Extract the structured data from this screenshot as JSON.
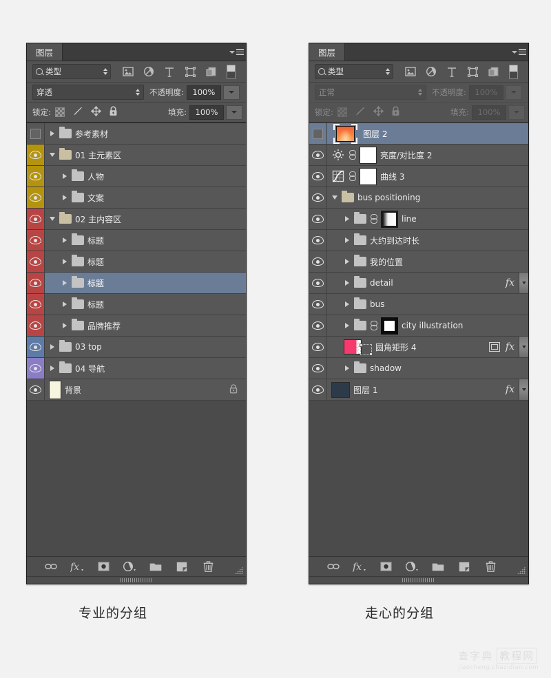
{
  "panels": [
    {
      "id": "left",
      "tab_label": "图层",
      "filter": {
        "kind_label": "类型",
        "icons": [
          "pixel-filter-icon",
          "adjustment-filter-icon",
          "type-filter-icon",
          "shape-filter-icon",
          "smartobject-filter-icon",
          "filter-toggle-switch"
        ]
      },
      "blend": {
        "mode": "穿透",
        "opacity_label": "不透明度:",
        "opacity_value": "100%",
        "disabled": false
      },
      "lock": {
        "label": "锁定:",
        "fill_label": "填充:",
        "fill_value": "100%",
        "icons": [
          "lock-transparency-icon",
          "lock-image-icon",
          "lock-position-icon",
          "lock-all-icon"
        ],
        "disabled": false
      },
      "layers": [
        {
          "name": "参考素材",
          "type": "group",
          "indent": 0,
          "visible": false,
          "expanded": false,
          "eye_color": null
        },
        {
          "name": "01 主元素区",
          "type": "group",
          "indent": 0,
          "visible": true,
          "expanded": true,
          "eye_color": "#b4940f"
        },
        {
          "name": "人物",
          "type": "group",
          "indent": 1,
          "visible": true,
          "expanded": false,
          "eye_color": "#b4940f"
        },
        {
          "name": "文案",
          "type": "group",
          "indent": 1,
          "visible": true,
          "expanded": false,
          "eye_color": "#b4940f"
        },
        {
          "name": "02 主内容区",
          "type": "group",
          "indent": 0,
          "visible": true,
          "expanded": true,
          "eye_color": "#b94444"
        },
        {
          "name": "标题",
          "type": "group",
          "indent": 1,
          "visible": true,
          "expanded": false,
          "eye_color": "#b94444"
        },
        {
          "name": "标题",
          "type": "group",
          "indent": 1,
          "visible": true,
          "expanded": false,
          "eye_color": "#b94444"
        },
        {
          "name": "标题",
          "type": "group",
          "indent": 1,
          "visible": true,
          "expanded": false,
          "eye_color": "#b94444",
          "selected": true
        },
        {
          "name": "标题",
          "type": "group",
          "indent": 1,
          "visible": true,
          "expanded": false,
          "eye_color": "#b94444"
        },
        {
          "name": "品牌推荐",
          "type": "group",
          "indent": 1,
          "visible": true,
          "expanded": false,
          "eye_color": "#b94444"
        },
        {
          "name": "03 top",
          "type": "group",
          "indent": 0,
          "visible": true,
          "expanded": false,
          "eye_color": "#5d7ba6"
        },
        {
          "name": "04 导航",
          "type": "group",
          "indent": 0,
          "visible": true,
          "expanded": false,
          "eye_color": "#8b7cc6"
        },
        {
          "name": "背景",
          "type": "background",
          "indent": 0,
          "visible": true,
          "locked": true,
          "eye_color": null
        }
      ]
    },
    {
      "id": "right",
      "tab_label": "图层",
      "filter": {
        "kind_label": "类型",
        "icons": [
          "pixel-filter-icon",
          "adjustment-filter-icon",
          "type-filter-icon",
          "shape-filter-icon",
          "smartobject-filter-icon",
          "filter-toggle-switch"
        ]
      },
      "blend": {
        "mode": "正常",
        "opacity_label": "不透明度:",
        "opacity_value": "100%",
        "disabled": true
      },
      "lock": {
        "label": "锁定:",
        "fill_label": "填充:",
        "fill_value": "100%",
        "icons": [
          "lock-transparency-icon",
          "lock-image-icon",
          "lock-position-icon",
          "lock-all-icon"
        ],
        "disabled": true
      },
      "layers": [
        {
          "name": "图层 2",
          "type": "image",
          "indent": 0,
          "visible": false,
          "selected": true,
          "eye_color": null
        },
        {
          "name": "亮度/对比度 2",
          "type": "adjustment",
          "adj": "brightness",
          "indent": 0,
          "visible": true,
          "mask": "white",
          "linked": true,
          "eye_color": null
        },
        {
          "name": "曲线 3",
          "type": "adjustment",
          "adj": "curves",
          "indent": 0,
          "visible": true,
          "mask": "white",
          "linked": true,
          "eye_color": null
        },
        {
          "name": "bus positioning",
          "type": "group",
          "indent": 0,
          "visible": true,
          "expanded": true,
          "eye_color": null
        },
        {
          "name": "line",
          "type": "group",
          "indent": 1,
          "visible": true,
          "expanded": false,
          "mask": "gradient",
          "linked": true,
          "eye_color": null
        },
        {
          "name": "大约到达时长",
          "type": "group",
          "indent": 1,
          "visible": true,
          "expanded": false,
          "eye_color": null
        },
        {
          "name": "我的位置",
          "type": "group",
          "indent": 1,
          "visible": true,
          "expanded": false,
          "eye_color": null
        },
        {
          "name": "detail",
          "type": "group",
          "indent": 1,
          "visible": true,
          "expanded": false,
          "fx": true,
          "expander": true,
          "eye_color": null
        },
        {
          "name": "bus",
          "type": "group",
          "indent": 1,
          "visible": true,
          "expanded": false,
          "eye_color": null
        },
        {
          "name": "city illustration",
          "type": "group",
          "indent": 1,
          "visible": true,
          "expanded": false,
          "mask": "city",
          "linked": true,
          "eye_color": null
        },
        {
          "name": "圆角矩形 4",
          "type": "shape",
          "indent": 1,
          "visible": true,
          "fx": true,
          "expander": true,
          "smart": true,
          "eye_color": null
        },
        {
          "name": "shadow",
          "type": "group",
          "indent": 1,
          "visible": true,
          "expanded": false,
          "eye_color": null
        },
        {
          "name": "图层 1",
          "type": "image-dark",
          "indent": 0,
          "visible": true,
          "fx": true,
          "expander": true,
          "eye_color": null
        }
      ]
    }
  ],
  "footer": {
    "buttons": [
      {
        "name": "link-layers-button",
        "icon": "link-icon"
      },
      {
        "name": "layer-style-button",
        "icon": "fx-icon"
      },
      {
        "name": "add-mask-button",
        "icon": "mask-icon"
      },
      {
        "name": "new-adjustment-button",
        "icon": "adjustment-icon"
      },
      {
        "name": "new-group-button",
        "icon": "folder-icon"
      },
      {
        "name": "new-layer-button",
        "icon": "new-layer-icon"
      },
      {
        "name": "delete-layer-button",
        "icon": "trash-icon"
      }
    ]
  },
  "captions": {
    "left": "专业的分组",
    "right": "走心的分组"
  },
  "watermark": {
    "brand_left": "查字典",
    "brand_right": "教程网",
    "url": "jiaocheng.chazidian.com"
  }
}
